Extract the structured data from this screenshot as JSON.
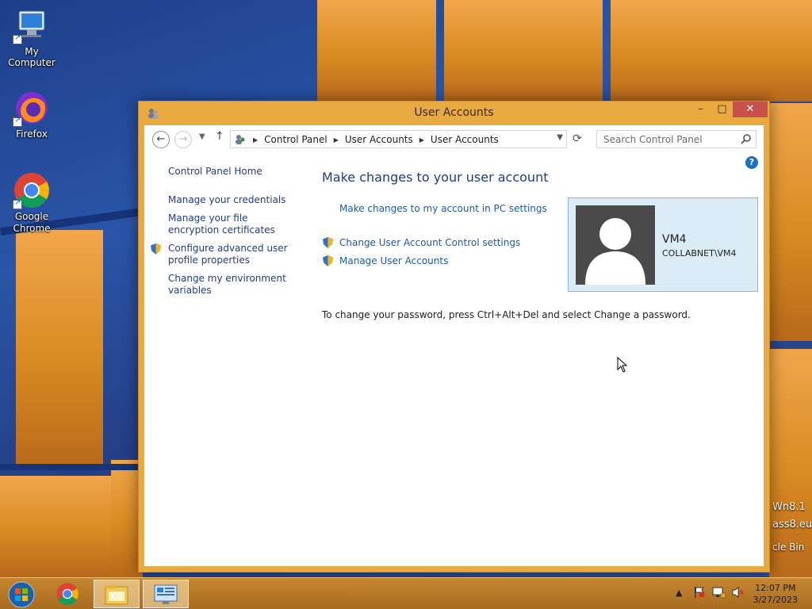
{
  "desktop": {
    "icons": [
      {
        "label": "My Computer"
      },
      {
        "label": "Firefox"
      },
      {
        "label": "Google Chrome"
      }
    ],
    "edge_text": [
      "Wn8.1",
      "ass8.eu",
      "cle Bin"
    ]
  },
  "window": {
    "title": "User Accounts",
    "controls": {
      "minimize": "–",
      "maximize": "□",
      "close": "✕"
    }
  },
  "address": {
    "crumbs": [
      "Control Panel",
      "User Accounts",
      "User Accounts"
    ]
  },
  "search": {
    "placeholder": "Search Control Panel"
  },
  "left_pane": {
    "home": "Control Panel Home",
    "items": [
      "Manage your credentials",
      "Manage your file encryption certificates",
      "Configure advanced user profile properties",
      "Change my environment variables"
    ]
  },
  "main": {
    "title": "Make changes to your user account",
    "links": [
      "Make changes to my account in PC settings",
      "Change User Account Control settings",
      "Manage User Accounts"
    ],
    "password_hint": "To change your password, press Ctrl+Alt+Del and select Change a password."
  },
  "user": {
    "name": "VM4",
    "domain": "COLLABNET\\VM4"
  },
  "taskbar": {
    "clock_time": "12:07 PM",
    "clock_date": "3/27/2023"
  },
  "colors": {
    "accent": "#e9a941",
    "link": "#1e5aa8",
    "user_box": "#dcecf7"
  }
}
